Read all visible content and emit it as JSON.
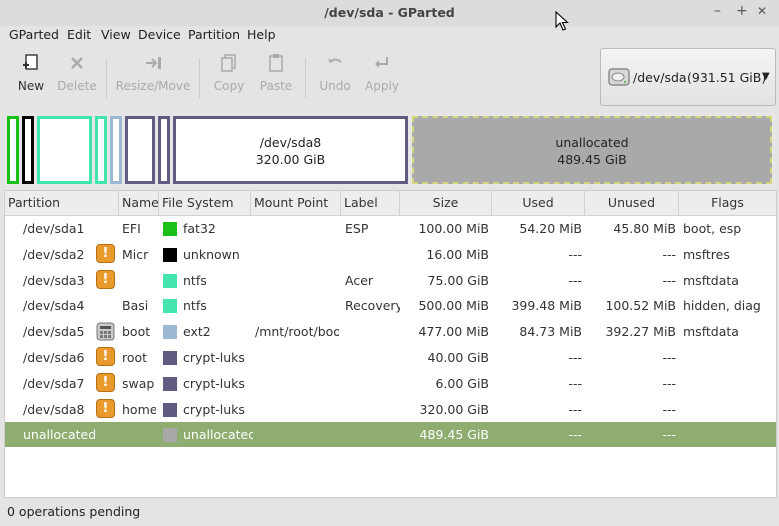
{
  "window": {
    "title": "/dev/sda - GParted",
    "minimize": "–",
    "maximize": "+",
    "close": "✕"
  },
  "menu": {
    "items": [
      "GParted",
      "Edit",
      "View",
      "Device",
      "Partition",
      "Help"
    ]
  },
  "toolbar": {
    "new": "New",
    "delete": "Delete",
    "resize_move": "Resize/Move",
    "copy": "Copy",
    "paste": "Paste",
    "undo": "Undo",
    "apply": "Apply"
  },
  "device_selector": {
    "device": "/dev/sda",
    "size": "(931.51 GiB)"
  },
  "map": {
    "sda8_name": "/dev/sda8",
    "sda8_size": "320.00 GiB",
    "unalloc_name": "unallocated",
    "unalloc_size": "489.45 GiB"
  },
  "table": {
    "headers": [
      "Partition",
      "Name",
      "File System",
      "Mount Point",
      "Label",
      "Size",
      "Used",
      "Unused",
      "Flags"
    ],
    "rows": [
      {
        "partition": "/dev/sda1",
        "warn": false,
        "lock": false,
        "name": "EFI",
        "fs": "fat32",
        "fs_color": "#18c018",
        "mount": "",
        "label": "ESP",
        "size": "100.00 MiB",
        "used": "54.20 MiB",
        "unused": "45.80 MiB",
        "flags": "boot, esp"
      },
      {
        "partition": "/dev/sda2",
        "warn": true,
        "lock": false,
        "name": "Micr",
        "fs": "unknown",
        "fs_color": "#000000",
        "mount": "",
        "label": "",
        "size": "16.00 MiB",
        "used": "---",
        "unused": "---",
        "flags": "msftres"
      },
      {
        "partition": "/dev/sda3",
        "warn": true,
        "lock": false,
        "name": "",
        "fs": "ntfs",
        "fs_color": "#42e5ac",
        "mount": "",
        "label": "Acer",
        "size": "75.00 GiB",
        "used": "---",
        "unused": "---",
        "flags": "msftdata"
      },
      {
        "partition": "/dev/sda4",
        "warn": false,
        "lock": false,
        "name": "Basi",
        "fs": "ntfs",
        "fs_color": "#42e5ac",
        "mount": "",
        "label": "Recovery",
        "size": "500.00 MiB",
        "used": "399.48 MiB",
        "unused": "100.52 MiB",
        "flags": "hidden, diag"
      },
      {
        "partition": "/dev/sda5",
        "warn": false,
        "lock": true,
        "name": "boot",
        "fs": "ext2",
        "fs_color": "#9db8d2",
        "mount": "/mnt/root/boot",
        "label": "",
        "size": "477.00 MiB",
        "used": "84.73 MiB",
        "unused": "392.27 MiB",
        "flags": "msftdata"
      },
      {
        "partition": "/dev/sda6",
        "warn": true,
        "lock": false,
        "name": "root",
        "fs": "crypt-luks",
        "fs_color": "#625b81",
        "mount": "",
        "label": "",
        "size": "40.00 GiB",
        "used": "---",
        "unused": "---",
        "flags": ""
      },
      {
        "partition": "/dev/sda7",
        "warn": true,
        "lock": false,
        "name": "swap",
        "fs": "crypt-luks",
        "fs_color": "#625b81",
        "mount": "",
        "label": "",
        "size": "6.00 GiB",
        "used": "---",
        "unused": "---",
        "flags": ""
      },
      {
        "partition": "/dev/sda8",
        "warn": true,
        "lock": false,
        "name": "home",
        "fs": "crypt-luks",
        "fs_color": "#625b81",
        "mount": "",
        "label": "",
        "size": "320.00 GiB",
        "used": "---",
        "unused": "---",
        "flags": ""
      },
      {
        "partition": "unallocated",
        "warn": false,
        "lock": false,
        "name": "",
        "fs": "unallocated",
        "fs_color": "#a9a9a9",
        "mount": "",
        "label": "",
        "size": "489.45 GiB",
        "used": "---",
        "unused": "---",
        "flags": "",
        "selected": true
      }
    ]
  },
  "status": {
    "text": "0 operations pending"
  }
}
